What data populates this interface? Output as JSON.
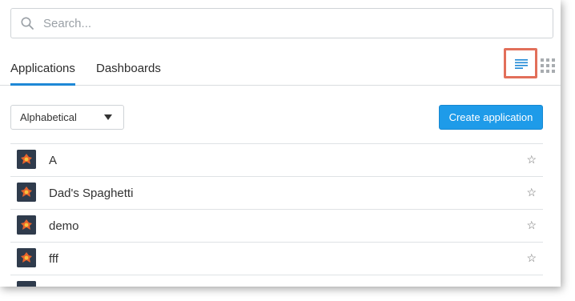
{
  "search": {
    "placeholder": "Search...",
    "value": ""
  },
  "tabs": [
    {
      "label": "Applications",
      "active": true
    },
    {
      "label": "Dashboards",
      "active": false
    }
  ],
  "view_toggle": {
    "list_icon": "list-view-icon",
    "grid_icon": "grid-view-icon",
    "highlight_color": "#e26f5a"
  },
  "sort": {
    "selected": "Alphabetical"
  },
  "create_button": {
    "label": "Create application",
    "color": "#1e9be9"
  },
  "accent_color": "#1e88d6",
  "applications": [
    {
      "name": "A",
      "icon": "app-icon",
      "favorite": false
    },
    {
      "name": "Dad's Spaghetti",
      "icon": "app-icon",
      "favorite": false
    },
    {
      "name": "demo",
      "icon": "app-icon",
      "favorite": false
    },
    {
      "name": "fff",
      "icon": "app-icon",
      "favorite": false
    }
  ]
}
